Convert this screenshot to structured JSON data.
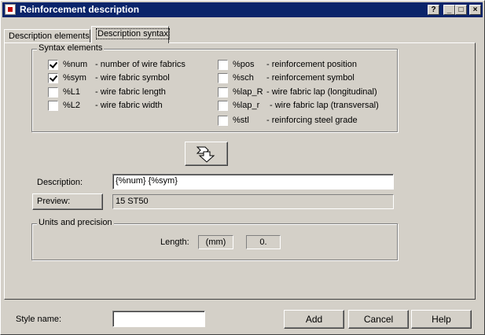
{
  "window": {
    "title": "Reinforcement description"
  },
  "tabs": [
    {
      "label": "Description elements"
    },
    {
      "label": "Description syntax"
    }
  ],
  "syntax_group": {
    "label": "Syntax elements",
    "left_items": [
      {
        "code": "%num",
        "desc": "- number of wire fabrics",
        "checked": true
      },
      {
        "code": "%sym",
        "desc": "- wire fabric symbol",
        "checked": true
      },
      {
        "code": "%L1",
        "desc": "- wire fabric length",
        "checked": false
      },
      {
        "code": "%L2",
        "desc": "- wire fabric width",
        "checked": false
      }
    ],
    "right_items": [
      {
        "code": "%pos",
        "desc": "- reinforcement position",
        "checked": false
      },
      {
        "code": "%sch",
        "desc": "- reinforcement symbol",
        "checked": false
      },
      {
        "code": "%lap_R",
        "desc": "- wire fabric lap (longitudinal)",
        "checked": false
      },
      {
        "code": "%lap_r",
        "desc": "- wire fabric lap (transversal)",
        "checked": false
      },
      {
        "code": "%stl",
        "desc": "- reinforcing steel grade",
        "checked": false
      }
    ]
  },
  "description": {
    "label": "Description:",
    "value": "{%num} {%sym}"
  },
  "preview": {
    "button_label": "Preview:",
    "value": "15 ST50"
  },
  "units_group": {
    "label": "Units and precision",
    "length_label": "Length:",
    "unit": "(mm)",
    "precision": "0."
  },
  "bottom": {
    "style_name_label": "Style name:",
    "style_name_value": "",
    "add_label": "Add",
    "cancel_label": "Cancel",
    "help_label": "Help"
  }
}
